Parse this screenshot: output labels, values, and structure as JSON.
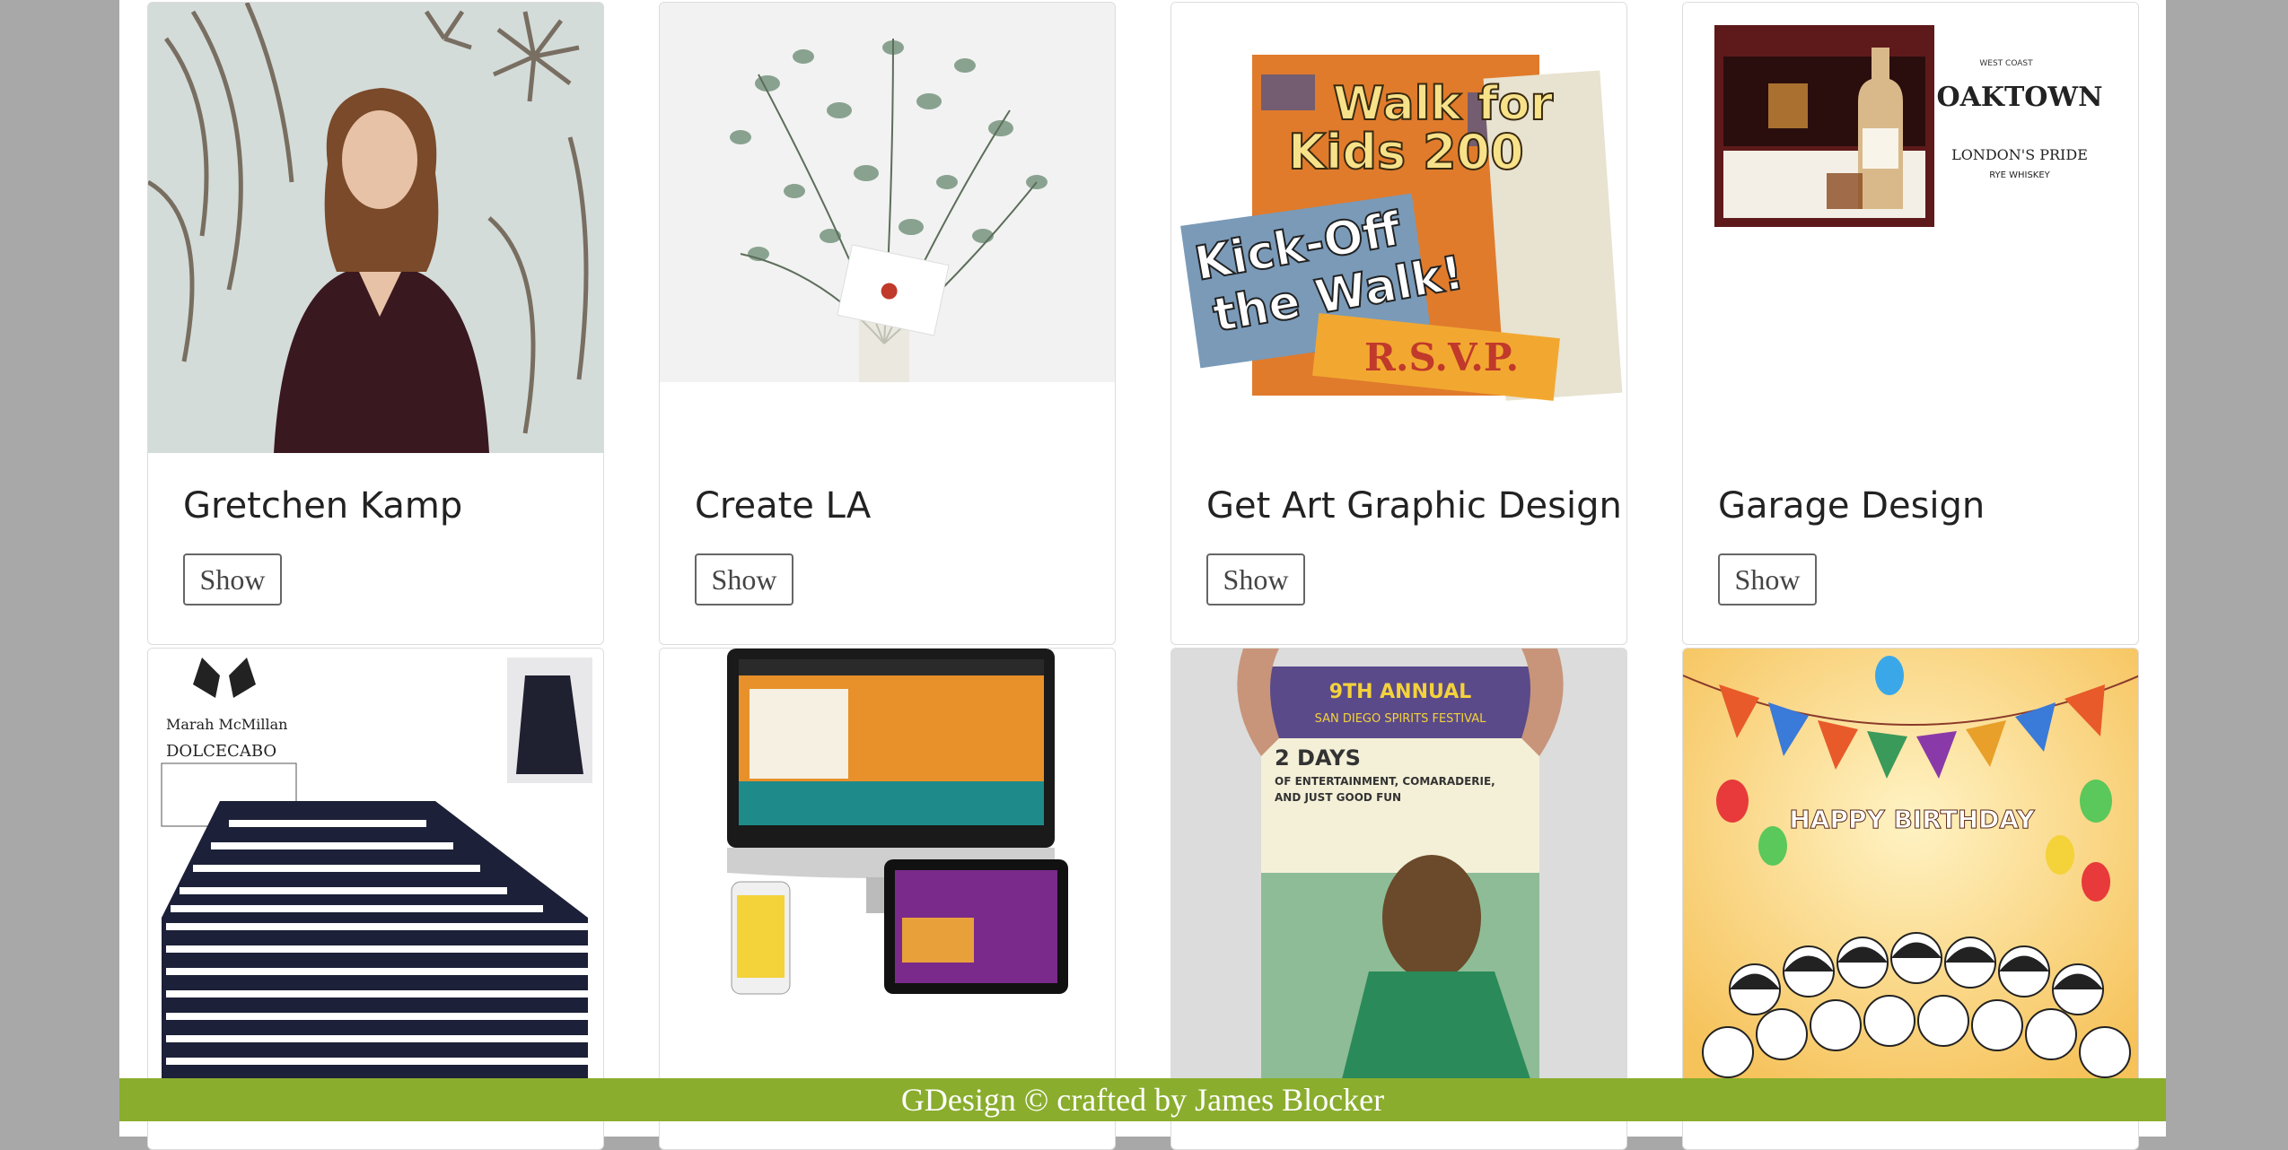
{
  "cards_row1": [
    {
      "title": "Gretchen Kamp",
      "button": "Show"
    },
    {
      "title": "Create LA",
      "button": "Show"
    },
    {
      "title": "Get Art Graphic Design",
      "button": "Show"
    },
    {
      "title": "Garage Design",
      "button": "Show"
    }
  ],
  "thumbs": {
    "walk": {
      "line1": "Walk for",
      "line2": "Kids 200",
      "kick1": "Kick-Off",
      "kick2": "the Walk!",
      "rsvp": "R.S.V.P."
    },
    "oaktown": {
      "brand": "OAKTOWN",
      "sub1": "LONDON'S PRIDE",
      "sub2": "RYE WHISKEY",
      "top": "WEST COAST"
    },
    "marah": {
      "brand1": "Marah McMillan",
      "brand2": "DOLCECABO"
    },
    "spirits": {
      "line1": "2 DAYS",
      "line2": "OF ENTERTAINMENT, COMARADERIE,",
      "line3": "AND JUST GOOD FUN",
      "head": "9TH ANNUAL",
      "fest": "SAN DIEGO SPIRITS FESTIVAL"
    },
    "birthday": {
      "letters": "HAPPY BIRTHDAY"
    }
  },
  "footer": {
    "text": "GDesign © crafted by James Blocker"
  }
}
